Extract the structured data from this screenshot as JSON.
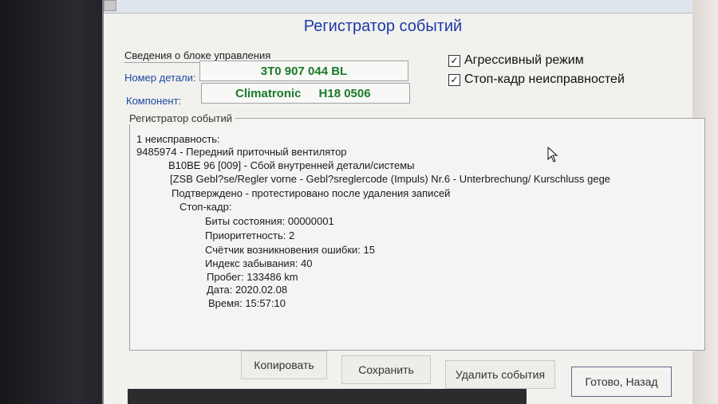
{
  "window": {
    "title": "Регистратор событий"
  },
  "control_unit": {
    "group_label": "Сведения о блоке управления",
    "part_number_label": "Номер детали:",
    "part_number_value": "3T0 907 044 BL",
    "component_label": "Компонент:",
    "component_name": "Climatronic",
    "component_version": "H18 0506"
  },
  "options": {
    "aggressive_mode": {
      "label": "Агрессивный режим",
      "checked": true,
      "mark": "✓"
    },
    "freeze_frame": {
      "label": "Стоп-кадр неисправностей",
      "checked": true,
      "mark": "✓"
    }
  },
  "event_log": {
    "group_label": "Регистратор событий",
    "lines": [
      "1 неисправность:",
      "9485974 - Передний приточный вентилятор",
      "B10BE 96 [009] - Сбой внутренней детали/системы",
      "[ZSB Gebl?se/Regler vorne - Gebl?sreglercode (Impuls) Nr.6 - Unterbrechung/ Kurschluss gege",
      "Подтверждено - протестировано после удаления записей",
      "Стоп-кадр:",
      "Биты состояния: 00000001",
      "Приоритетность: 2",
      "Счётчик возникновения ошибки: 15",
      "Индекс забывания: 40",
      "Пробег: 133486 km",
      "Дата: 2020.02.08",
      "Время: 15:57:10"
    ]
  },
  "buttons": {
    "copy": "Копировать",
    "save": "Сохранить",
    "delete_events": "Удалить события",
    "done_back": "Готово, Назад"
  }
}
